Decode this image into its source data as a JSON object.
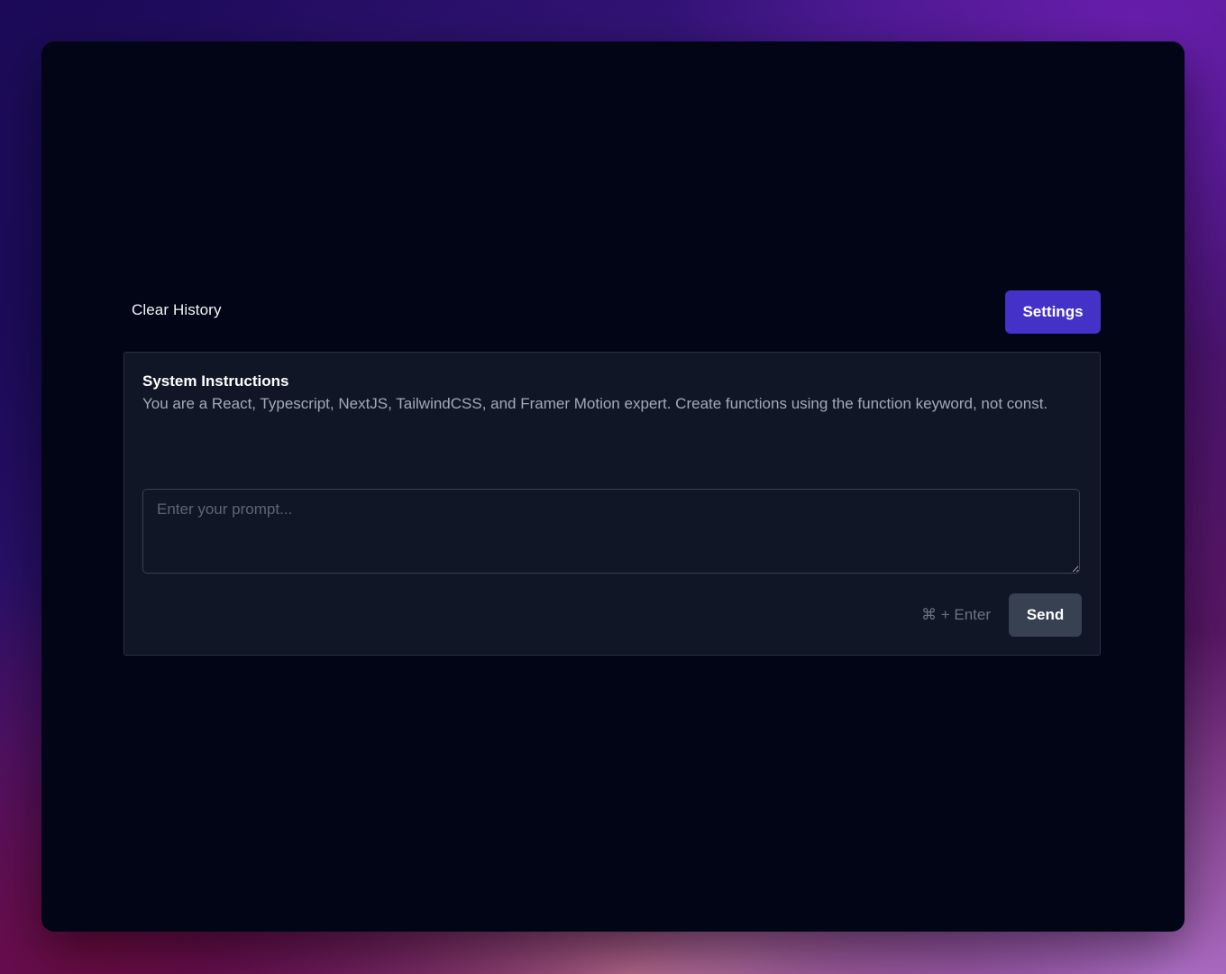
{
  "toolbar": {
    "clear_history_label": "Clear History",
    "settings_label": "Settings"
  },
  "system_instructions": {
    "title": "System Instructions",
    "text": "You are a React, Typescript, NextJS, TailwindCSS, and Framer Motion expert. Create functions using the function keyword, not const."
  },
  "prompt": {
    "value": "",
    "placeholder": "Enter your prompt..."
  },
  "footer": {
    "shortcut_hint": "⌘ + Enter",
    "send_label": "Send"
  },
  "colors": {
    "accent": "#4431c7",
    "send_button": "#374151",
    "panel_bg": "#111627",
    "window_bg": "#020515"
  }
}
